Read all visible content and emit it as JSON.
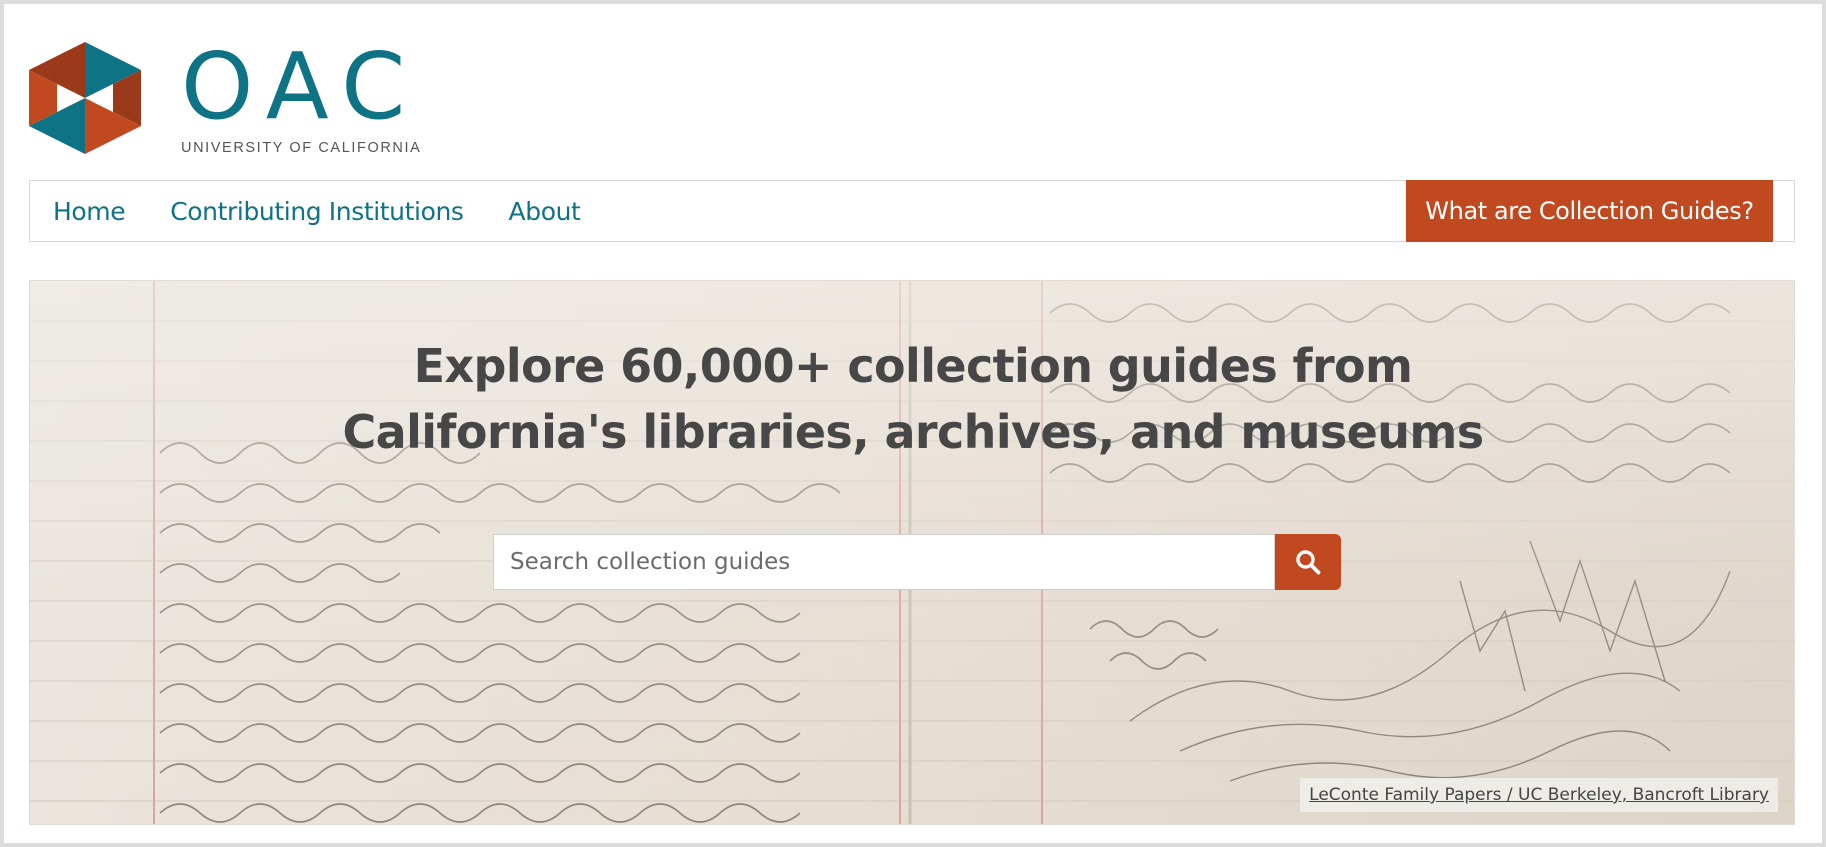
{
  "brand": {
    "name": "OAC",
    "subtitle": "UNIVERSITY OF CALIFORNIA",
    "colors": {
      "teal": "#0e7385",
      "orange": "#c1491f",
      "dark_orange": "#9a3a1a"
    }
  },
  "nav": {
    "items": [
      {
        "label": "Home"
      },
      {
        "label": "Contributing Institutions"
      },
      {
        "label": "About"
      }
    ],
    "cta_label": "What are Collection Guides?"
  },
  "hero": {
    "title_line1": "Explore 60,000+ collection guides from",
    "title_line2": "California's libraries, archives, and museums",
    "search": {
      "placeholder": "Search collection guides",
      "value": "",
      "button_icon": "search-icon"
    },
    "credit": "LeConte Family Papers / UC Berkeley, Bancroft Library"
  }
}
